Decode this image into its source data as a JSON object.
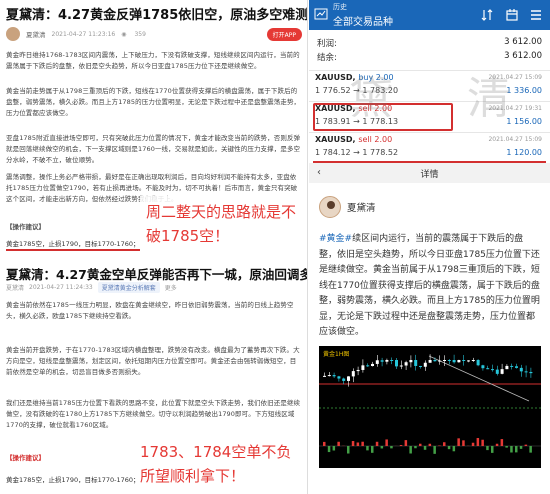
{
  "left": {
    "title": "夏黛清：4.27黄金反弹1785依旧空，原油多空难测！",
    "meta": {
      "author": "夏黛清",
      "datetime": "2021-04-27 11:23:16",
      "views": "359",
      "app_button": "打开APP"
    },
    "paras": [
      "黄金昨日维持1768-1783区间内震荡，上下破压力，下没有跌破支撑，短线继续区间内运行，当前的震荡属于下跌后的盘整，依旧是空头趋势，所以今日亚盘1785压力位下还是继续做空。",
      "黄金当前走势属于从1798三重顶后的下跌，短线在1770位置获得支撑后的横盘震荡，属于下跌后的盘整，弱势震荡，横久必跌。而且上方1785的压力位置明显，无论是下跌过程中还是盘整震荡走势，压力位置都应该做空。",
      "亚盘1785附近直接进场空即可，只有突破此压力位置的情况下，黄金才能改变当前的跌势，否则反弹就是回落继续做空的机会，下一支撑区域则是1760一线，交易就是如此，关键性的压力支撑，是多空分水岭，不破不立，破位顺势。",
      "震荡调整，操作上务必严格带损，最好是在正确出现取利润后，目向均好利润不能持有太多，亚盘依托1785压力位置做空1790，若有止损再进场。不能及时为，切不可执着！后市而言，黄金只有突破这个区间，才能走出新方向，但依然经过跌势我们稳于上。"
    ],
    "ops_label1": "【操作建议】",
    "ops_text1": "黄金1785空，止损1790，目标1770-1760；",
    "annotation1": "周二整天的思路就是不破1785空！",
    "title2": "夏黛清：4.27黄金空单反弹能否再下一城，原油回调多！",
    "meta2": {
      "author": "夏黛清",
      "datetime": "2021-04-27 11:24:33",
      "tag": "夏黛清黄金分析解套",
      "more": "更多"
    },
    "paras2": [
      "黄金当前依然在1785一线压力明显，欧盘在黄金继续空，昨日依旧弱势震荡，当前的日线上趋势空头，横久必跌，欧盘1785下继续持空看跌。",
      "黄金当前开盘跌势，于在1770-1783区域内横盘整理，跌势没有改变。横盘最为了蓄势再次下跌。大方向是空，短线是盘整震荡，划定区间，依托短期内压力位置空即可。黄金还会由强转弱做短空，目前依然是空单的机会，切忌盲目做多否则损失。",
      "我们还是维持当前1785压力位置下看跌的思路不变，此位置下就是空头下跌走势，我们依旧还是继续做空，没有跌破的在1780上方1785下方继续做空。切守以利润趋势破出1790即可。下方短线区域1770的支撑，破位就看1760区域。"
    ],
    "ops_label2": "【操作建议】",
    "ops_text2": "黄金1785空，止损1790，目标1770-1760；",
    "annotation2": "1783、1784空单不负所望顺利拿下！"
  },
  "phone": {
    "sub_title": "历史",
    "main_title": "全部交易品种",
    "account": [
      {
        "label": "利润:",
        "value": "3 612.00"
      },
      {
        "label": "结余:",
        "value": "3 612.00"
      }
    ],
    "orders": [
      {
        "symbol": "XAUUSD,",
        "side": "buy 2.00",
        "side_type": "buy",
        "prices": "1 776.52 → 1 783.20",
        "datetime": "2021.04.27 15:09",
        "profit": "1 336.00"
      },
      {
        "symbol": "XAUUSD,",
        "side": "sell 2.00",
        "side_type": "sell",
        "prices": "1 783.91 → 1 778.13",
        "datetime": "2021.04.27 19:31",
        "profit": "1 156.00"
      },
      {
        "symbol": "XAUUSD,",
        "side": "sell 2.00",
        "side_type": "sell",
        "prices": "1 784.12 → 1 778.52",
        "datetime": "2021.04.27 15:09",
        "profit": "1 120.00"
      }
    ],
    "detail_label": "详情",
    "profile_name": "夏黛清",
    "post_hash": "#黄金#",
    "post_text": "续区间内运行，当前的震荡属于下跌后的盘整，依旧是空头趋势，所以今日亚盘1785压力位置下还是继续做空。黄金当前属于从1798三重顶后的下跌，短线在1770位置获得支撑后的横盘震荡，属于下跌后的盘整，弱势震荡，横久必跌。而且上方1785的压力位置明显，无论是下跌过程中还是盘整震荡走势，压力位置都应该做空。",
    "chart_title": "黄金1H图",
    "watermark": "黛 清"
  },
  "colors": {
    "accent_blue": "#1a67b8",
    "accent_red": "#d32f2f",
    "annotation_red": "#e53935"
  }
}
